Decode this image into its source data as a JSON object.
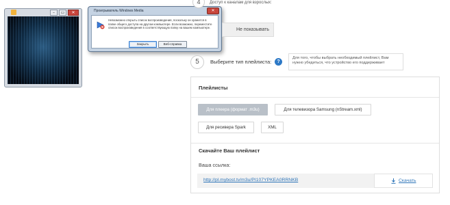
{
  "dialog": {
    "title": "Проигрыватель Windows Media",
    "close_glyph": "✕",
    "message": "Невозможно открыть список воспроизведения, поскольку он хранится в папке общего доступа на другом компьютере. Если возможно, переместите список воспроизведения в соответствующую папку на вашем компьютере.",
    "ok_label": "Закрыть",
    "help_label": "Веб-справка"
  },
  "player": {
    "minimize": "–",
    "maximize": "▭",
    "close": "✕"
  },
  "step4": {
    "number": "4",
    "text": "Доступ к каналам для взрослых:",
    "option_label": "Не показывать"
  },
  "step5": {
    "number": "5",
    "label": "Выберите тип плейлиста:",
    "help_glyph": "?",
    "tip": "Для того, чтобы выбрать необходимый плейлист, Вам нужно убедиться, что устройство его поддерживает"
  },
  "playlists": {
    "heading": "Плейлисты",
    "options": [
      "Для плеера (формат .m3u)",
      "Для телевизора Samsung (nStream.xml)",
      "Для ресивера Spark",
      "XML"
    ],
    "selected": 0
  },
  "download": {
    "heading": "Скачайте Ваш плейлист",
    "link_label": "Ваша ссылка:",
    "url": "http://pl.mybost.tv/m3u/PI107YPKEA0RRNKB",
    "button_label": "Скачать"
  }
}
